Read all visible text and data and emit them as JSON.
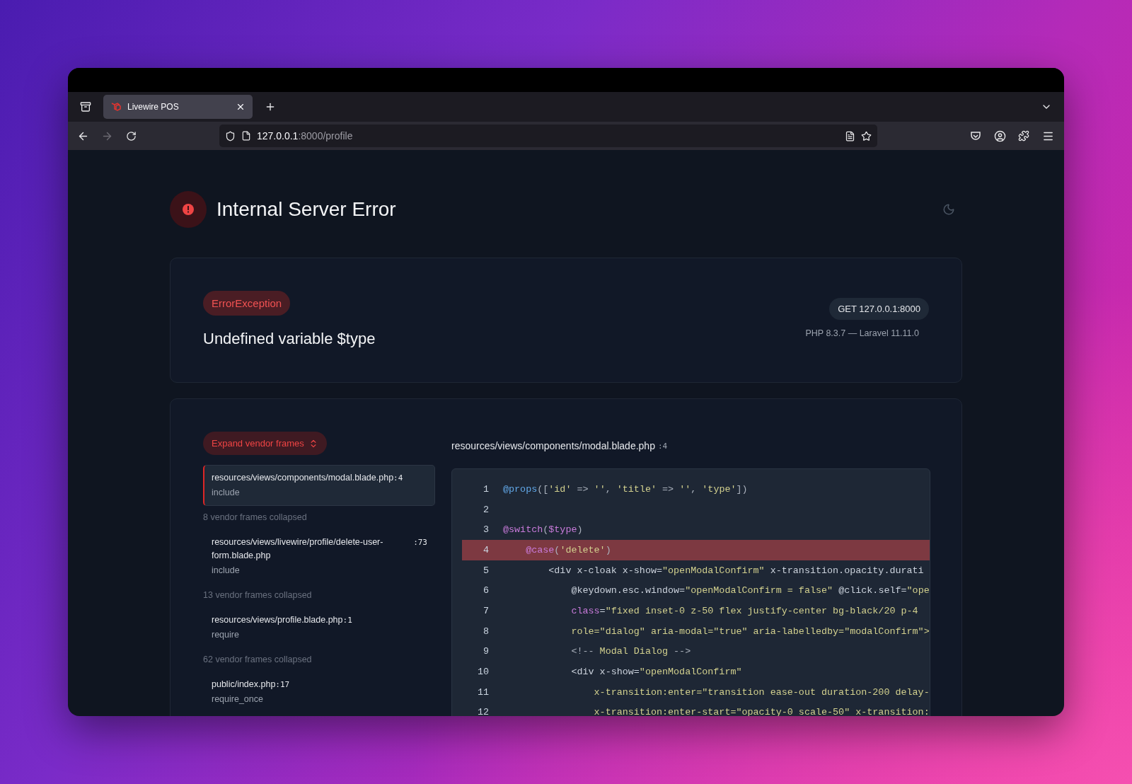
{
  "browser": {
    "tabs": [
      {
        "title": "Livewire POS",
        "selected": true
      }
    ],
    "url": {
      "host": "127.0.0.1",
      "path": ":8000/profile"
    }
  },
  "page": {
    "title": "Internal Server Error"
  },
  "exception": {
    "class": "ErrorException",
    "message": "Undefined variable $type",
    "request": "GET 127.0.0.1:8000",
    "versions": "PHP 8.3.7 — Laravel 11.11.0"
  },
  "trace": {
    "expand_button": "Expand vendor frames",
    "frames": [
      {
        "kind": "frame",
        "file": "resources/views/components/modal.blade.php",
        "line": ":4",
        "call": "include",
        "selected": true
      },
      {
        "kind": "collapsed",
        "text": "8 vendor frames collapsed"
      },
      {
        "kind": "frame",
        "file": "resources/views/livewire/profile/delete-user-form.blade.php",
        "line": ":73",
        "call": "include",
        "selected": false
      },
      {
        "kind": "collapsed",
        "text": "13 vendor frames collapsed"
      },
      {
        "kind": "frame",
        "file": "resources/views/profile.blade.php",
        "line": ":1",
        "call": "require",
        "selected": false
      },
      {
        "kind": "collapsed",
        "text": "62 vendor frames collapsed"
      },
      {
        "kind": "frame",
        "file": "public/index.php",
        "line": ":17",
        "call": "require_once",
        "selected": false
      }
    ],
    "file_header": {
      "path": "resources/views/components/modal.blade.php",
      "line": ":4"
    },
    "code": [
      {
        "number": "1",
        "highlighted": false,
        "tokens": [
          {
            "text": "@props",
            "kind": "directive"
          },
          {
            "text": "([",
            "kind": "punct"
          },
          {
            "text": "'id'",
            "kind": "string"
          },
          {
            "text": " => ",
            "kind": "punct"
          },
          {
            "text": "''",
            "kind": "string"
          },
          {
            "text": ", ",
            "kind": "punct"
          },
          {
            "text": "'title'",
            "kind": "string"
          },
          {
            "text": " => ",
            "kind": "punct"
          },
          {
            "text": "''",
            "kind": "string"
          },
          {
            "text": ", ",
            "kind": "punct"
          },
          {
            "text": "'type'",
            "kind": "string"
          },
          {
            "text": "])",
            "kind": "punct"
          }
        ]
      },
      {
        "number": "2",
        "highlighted": false
      },
      {
        "number": "3",
        "highlighted": false,
        "tokens": [
          {
            "text": "@switch",
            "kind": "keyword"
          },
          {
            "text": "(",
            "kind": "punct"
          },
          {
            "text": "$type",
            "kind": "keyword"
          },
          {
            "text": ")",
            "kind": "punct"
          }
        ]
      },
      {
        "number": "4",
        "highlighted": true,
        "tokens": [
          {
            "text": "    @case",
            "kind": "keyword"
          },
          {
            "text": "(",
            "kind": "punct"
          },
          {
            "text": "'delete'",
            "kind": "string"
          },
          {
            "text": ")",
            "kind": "punct"
          }
        ]
      },
      {
        "number": "5",
        "highlighted": false,
        "tokens": [
          {
            "text": "        <div x-cloak x-show=",
            "kind": "plain"
          },
          {
            "text": "\"openModalConfirm\"",
            "kind": "string"
          },
          {
            "text": " x-transition.opacity.durati",
            "kind": "plain"
          }
        ]
      },
      {
        "number": "6",
        "highlighted": false,
        "tokens": [
          {
            "text": "            @keydown.esc.window=",
            "kind": "plain"
          },
          {
            "text": "\"openModalConfirm = false\"",
            "kind": "string"
          },
          {
            "text": " @click.self=",
            "kind": "plain"
          },
          {
            "text": "\"ope",
            "kind": "string"
          }
        ]
      },
      {
        "number": "7",
        "highlighted": false,
        "tokens": [
          {
            "text": "            class",
            "kind": "keyword"
          },
          {
            "text": "=",
            "kind": "plain"
          },
          {
            "text": "\"fixed inset-0 z-50 flex justify-center bg-black/20 p-4",
            "kind": "string"
          }
        ]
      },
      {
        "number": "8",
        "highlighted": false,
        "tokens": [
          {
            "text": "            role=\"dialog\" aria-modal=\"true\" aria-labelledby=\"modalConfirm\">",
            "kind": "string"
          }
        ]
      },
      {
        "number": "9",
        "highlighted": false,
        "tokens": [
          {
            "text": "            <!-- ",
            "kind": "punct"
          },
          {
            "text": "Modal Dialog",
            "kind": "string"
          },
          {
            "text": " -->",
            "kind": "punct"
          }
        ]
      },
      {
        "number": "10",
        "highlighted": false,
        "tokens": [
          {
            "text": "            <div x-show=",
            "kind": "plain"
          },
          {
            "text": "\"openModalConfirm\"",
            "kind": "string"
          }
        ]
      },
      {
        "number": "11",
        "highlighted": false,
        "tokens": [
          {
            "text": "                x-transition:enter=\"transition ease-out duration-200 delay-",
            "kind": "string"
          }
        ]
      },
      {
        "number": "12",
        "highlighted": false,
        "tokens": [
          {
            "text": "                x-transition:enter-start=\"opacity-0 scale-50\" x-transition:",
            "kind": "string"
          }
        ]
      }
    ]
  }
}
